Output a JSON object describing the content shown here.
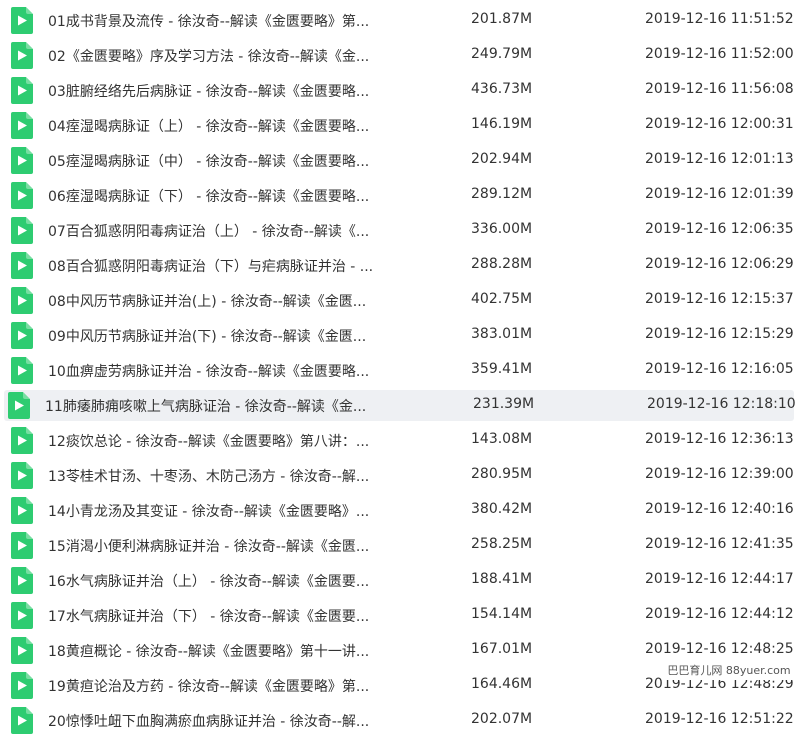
{
  "files": [
    {
      "name": "01成书背景及流传 - 徐汝奇--解读《金匮要略》第...",
      "size": "201.87M",
      "modified": "2019-12-16 11:51:52"
    },
    {
      "name": "02《金匮要略》序及学习方法 - 徐汝奇--解读《金...",
      "size": "249.79M",
      "modified": "2019-12-16 11:52:00"
    },
    {
      "name": "03脏腑经络先后病脉证 - 徐汝奇--解读《金匮要略...",
      "size": "436.73M",
      "modified": "2019-12-16 11:56:08"
    },
    {
      "name": "04痓湿暍病脉证（上） - 徐汝奇--解读《金匮要略...",
      "size": "146.19M",
      "modified": "2019-12-16 12:00:31"
    },
    {
      "name": "05痓湿暍病脉证（中） - 徐汝奇--解读《金匮要略...",
      "size": "202.94M",
      "modified": "2019-12-16 12:01:13"
    },
    {
      "name": "06痓湿暍病脉证（下） - 徐汝奇--解读《金匮要略...",
      "size": "289.12M",
      "modified": "2019-12-16 12:01:39"
    },
    {
      "name": "07百合狐惑阴阳毒病证治（上） - 徐汝奇--解读《...",
      "size": "336.00M",
      "modified": "2019-12-16 12:06:35"
    },
    {
      "name": "08百合狐惑阴阳毒病证治（下）与疟病脉证并治 - ...",
      "size": "288.28M",
      "modified": "2019-12-16 12:06:29"
    },
    {
      "name": "08中风历节病脉证并治(上) - 徐汝奇--解读《金匮...",
      "size": "402.75M",
      "modified": "2019-12-16 12:15:37"
    },
    {
      "name": "09中风历节病脉证并治(下) - 徐汝奇--解读《金匮...",
      "size": "383.01M",
      "modified": "2019-12-16 12:15:29"
    },
    {
      "name": "10血痹虚劳病脉证并治 - 徐汝奇--解读《金匮要略...",
      "size": "359.41M",
      "modified": "2019-12-16 12:16:05"
    },
    {
      "name": "11肺痿肺痈咳嗽上气病脉证治 - 徐汝奇--解读《金...",
      "size": "231.39M",
      "modified": "2019-12-16 12:18:10",
      "selected": true
    },
    {
      "name": "12痰饮总论 - 徐汝奇--解读《金匮要略》第八讲：...",
      "size": "143.08M",
      "modified": "2019-12-16 12:36:13"
    },
    {
      "name": "13苓桂术甘汤、十枣汤、木防己汤方 - 徐汝奇--解...",
      "size": "280.95M",
      "modified": "2019-12-16 12:39:00"
    },
    {
      "name": "14小青龙汤及其变证 - 徐汝奇--解读《金匮要略》...",
      "size": "380.42M",
      "modified": "2019-12-16 12:40:16"
    },
    {
      "name": "15消渴小便利淋病脉证并治 - 徐汝奇--解读《金匮...",
      "size": "258.25M",
      "modified": "2019-12-16 12:41:35"
    },
    {
      "name": "16水气病脉证并治（上） - 徐汝奇--解读《金匮要...",
      "size": "188.41M",
      "modified": "2019-12-16 12:44:17"
    },
    {
      "name": "17水气病脉证并治（下） - 徐汝奇--解读《金匮要...",
      "size": "154.14M",
      "modified": "2019-12-16 12:44:12"
    },
    {
      "name": "18黄疸概论 - 徐汝奇--解读《金匮要略》第十一讲...",
      "size": "167.01M",
      "modified": "2019-12-16 12:48:25"
    },
    {
      "name": "19黄疸论治及方药 - 徐汝奇--解读《金匮要略》第...",
      "size": "164.46M",
      "modified": "2019-12-16 12:48:29"
    },
    {
      "name": "20惊悸吐衄下血胸满瘀血病脉证并治 - 徐汝奇--解...",
      "size": "202.07M",
      "modified": "2019-12-16 12:51:22"
    }
  ],
  "file_icon": {
    "name": "video-file-icon",
    "color": "#2ecc71"
  },
  "watermark": "巴巴育儿网 88yuer.com"
}
